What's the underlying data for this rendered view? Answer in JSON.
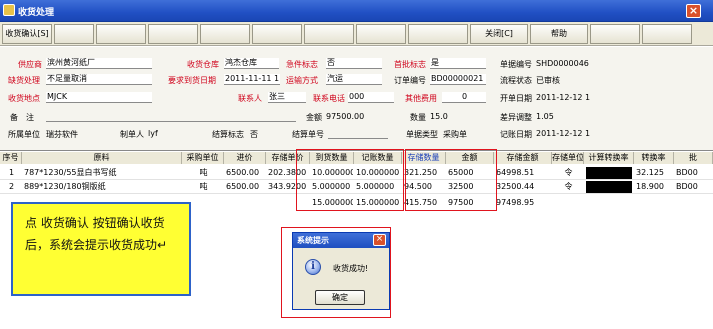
{
  "window": {
    "title": "收货处理",
    "close_glyph": "×"
  },
  "toolbar": {
    "confirm_label": "收货确认[S]",
    "close_label": "关闭[C]",
    "help_label": "帮助"
  },
  "form": {
    "supplier_label": "供应商",
    "supplier_value": "滨州黄河纸厂",
    "warehouse_label": "收货仓库",
    "warehouse_value": "鸿杰仓库",
    "urgent_label": "急件标志",
    "urgent_value": "否",
    "first_label": "首批标志",
    "first_value": "是",
    "receipt_no_label": "单据编号",
    "receipt_no_value": "SHD0000046",
    "shortage_label": "缺货处理",
    "shortage_value": "不足量取消",
    "req_date_label": "要求到货日期",
    "req_date_value": "2011-11-11 11",
    "transport_label": "运输方式",
    "transport_value": "汽运",
    "order_no_label": "订单编号",
    "order_no_value": "BD00000021",
    "flow_label": "流程状态",
    "flow_value": "已审核",
    "location_label": "收货地点",
    "location_value": "MJCK",
    "contact_label": "联系人",
    "contact_value": "张三",
    "phone_label": "联系电话",
    "phone_value": "000",
    "other_fee_label": "其他费用",
    "other_fee_value": "0",
    "open_date_label": "开单日期",
    "open_date_value": "2011-12-12 1",
    "remark_label": "备　注",
    "remark_value": "",
    "amount_label": "金额",
    "amount_value": "97500.00",
    "qty_label": "数量",
    "qty_value": "15.0",
    "diff_label": "差异调整",
    "diff_value": "1.05",
    "unit_label": "所属单位",
    "unit_value": "瑞芬软件",
    "maker_label": "制单人",
    "maker_value": "lyf",
    "settle_label": "结算标志",
    "settle_value": "否",
    "settle_no_label": "结算单号",
    "settle_no_value": "",
    "doc_type_label": "单据类型",
    "doc_type_value": "采购单",
    "account_date_label": "记账日期",
    "account_date_value": "2011-12-12 1"
  },
  "grid": {
    "headers": [
      "序号",
      "原料",
      "采购单位",
      "进价",
      "存储单价",
      "到货数量",
      "记账数量",
      "存储数量",
      "金额",
      "存储金额",
      "存储单位",
      "计算转换率",
      "转换率",
      "批"
    ],
    "rows": [
      [
        "1",
        "787*1230/55显白书写纸",
        "吨",
        "6500.00",
        "202.3800",
        "10.000000",
        "10.000000",
        "321.250",
        "65000",
        "64998.51",
        "令",
        "",
        "32.125",
        "BD00"
      ],
      [
        "2",
        "889*1230/180铜版纸",
        "吨",
        "6500.00",
        "343.9200",
        "5.000000",
        "5.000000",
        "94.500",
        "32500",
        "32500.44",
        "令",
        "",
        "18.900",
        "BD00"
      ]
    ],
    "totals": [
      "15.000000",
      "15.000000",
      "415.750",
      "97500",
      "97498.95"
    ]
  },
  "callout": {
    "text": "点 收货确认 按钮确认收货后，系统会提示收货成功↵"
  },
  "dialog": {
    "title": "系统提示",
    "message": "收货成功!",
    "ok_label": "确定",
    "icon_glyph": "i",
    "close_glyph": "×"
  },
  "colors": {
    "titlebar": "#2150c4",
    "highlight": "#e0141e",
    "callout_bg": "#ffff33"
  }
}
